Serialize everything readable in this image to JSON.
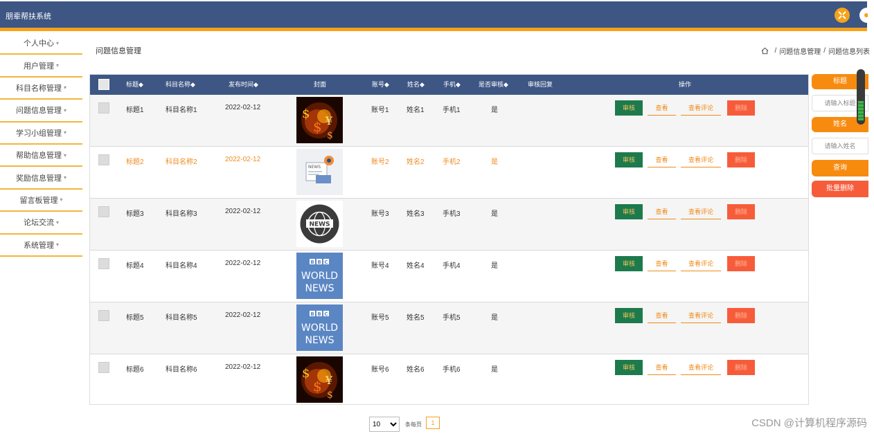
{
  "app": {
    "title": "朋辈帮扶系统"
  },
  "sidebar": {
    "items": [
      {
        "label": "个人中心"
      },
      {
        "label": "用户管理"
      },
      {
        "label": "科目名称管理"
      },
      {
        "label": "问题信息管理"
      },
      {
        "label": "学习小组管理"
      },
      {
        "label": "帮助信息管理"
      },
      {
        "label": "奖励信息管理"
      },
      {
        "label": "留言板管理"
      },
      {
        "label": "论坛交流"
      },
      {
        "label": "系统管理"
      }
    ],
    "caret": "▾"
  },
  "page": {
    "title": "问题信息管理",
    "breadcrumb": [
      "问题信息管理",
      "问题信息列表"
    ],
    "breadcrumb_sep": "/"
  },
  "table": {
    "headers": {
      "title": "标题◆",
      "subject": "科目名称◆",
      "date": "发布时间◆",
      "cover": "封面",
      "account": "账号◆",
      "name": "姓名◆",
      "phone": "手机◆",
      "reviewed": "是否审核◆",
      "reply": "审核回复",
      "actions": "操作"
    },
    "rows": [
      {
        "title": "标题1",
        "subject": "科目名称1",
        "date": "2022-02-12",
        "account": "账号1",
        "name": "姓名1",
        "phone": "手机1",
        "reviewed": "是",
        "cover": "fire-money-image"
      },
      {
        "title": "标题2",
        "subject": "科目名称2",
        "date": "2022-02-12",
        "account": "账号2",
        "name": "姓名2",
        "phone": "手机2",
        "reviewed": "是",
        "cover": "news-illustration-image"
      },
      {
        "title": "标题3",
        "subject": "科目名称3",
        "date": "2022-02-12",
        "account": "账号3",
        "name": "姓名3",
        "phone": "手机3",
        "reviewed": "是",
        "cover": "news-globe-icon"
      },
      {
        "title": "标题4",
        "subject": "科目名称4",
        "date": "2022-02-12",
        "account": "账号4",
        "name": "姓名4",
        "phone": "手机4",
        "reviewed": "是",
        "cover": "bbc-world-news-logo"
      },
      {
        "title": "标题5",
        "subject": "科目名称5",
        "date": "2022-02-12",
        "account": "账号5",
        "name": "姓名5",
        "phone": "手机5",
        "reviewed": "是",
        "cover": "bbc-world-news-logo"
      },
      {
        "title": "标题6",
        "subject": "科目名称6",
        "date": "2022-02-12",
        "account": "账号6",
        "name": "姓名6",
        "phone": "手机6",
        "reviewed": "是",
        "cover": "fire-money-image"
      }
    ],
    "actions": {
      "review": "审核",
      "view": "查看",
      "comments": "查看评论",
      "delete": "删除"
    }
  },
  "bbc_logo": {
    "letters": "BBC",
    "line1": "WORLD",
    "line2": "NEWS"
  },
  "news_badge": "NEWS",
  "news_tag": "NEWS",
  "search": {
    "title_label": "标题",
    "title_placeholder": "请输入标题",
    "name_label": "姓名",
    "name_placeholder": "请输入姓名",
    "query_button": "查询",
    "batch_delete_button": "批量删除"
  },
  "pagination": {
    "page_size": "10",
    "page_size_options": [
      "10"
    ],
    "per_page_label": "条每页",
    "current_page": "1"
  },
  "watermark": "CSDN @计算机程序源码",
  "colors": {
    "header_bg": "#3d5684",
    "accent_gold": "#f5a21b",
    "orange": "#f78b0f",
    "review_green": "#1d7a4c",
    "delete_red": "#f75c3a"
  }
}
